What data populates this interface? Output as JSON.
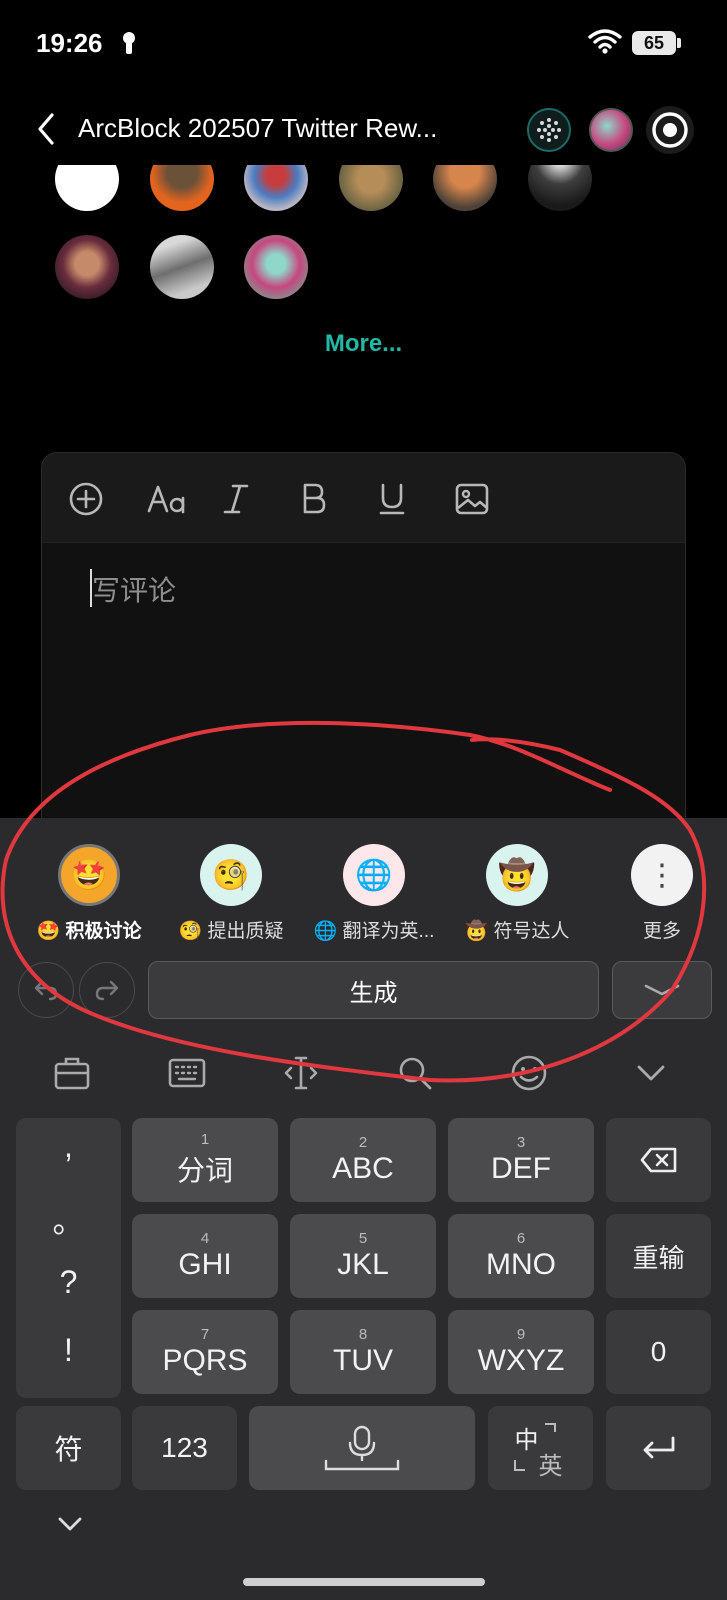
{
  "status_bar": {
    "time": "19:26",
    "battery": "65"
  },
  "header": {
    "title": "ArcBlock 202507 Twitter Rew..."
  },
  "avatars_more": "More...",
  "editor": {
    "placeholder": "写评论"
  },
  "suggestions": [
    {
      "emoji": "🤩",
      "label": "🤩 积极讨论",
      "selected": true
    },
    {
      "emoji": "🧐",
      "label": "🧐 提出质疑"
    },
    {
      "emoji": "🌐",
      "label": "🌐 翻译为英..."
    },
    {
      "emoji": "🤠",
      "label": "🤠 符号达人"
    },
    {
      "emoji": "⋮",
      "label": "更多"
    }
  ],
  "generate_label": "生成",
  "keyboard": {
    "punct": [
      ",",
      "。",
      "?",
      "!"
    ],
    "rows": [
      [
        {
          "num": "1",
          "label": "分词"
        },
        {
          "num": "2",
          "label": "ABC"
        },
        {
          "num": "3",
          "label": "DEF"
        }
      ],
      [
        {
          "num": "4",
          "label": "GHI"
        },
        {
          "num": "5",
          "label": "JKL"
        },
        {
          "num": "6",
          "label": "MNO"
        }
      ],
      [
        {
          "num": "7",
          "label": "PQRS"
        },
        {
          "num": "8",
          "label": "TUV"
        },
        {
          "num": "9",
          "label": "WXYZ"
        }
      ]
    ],
    "reenter": "重输",
    "zero": "0",
    "symbol": "符",
    "numbers": "123",
    "lang_top": "中",
    "lang_bottom": "英"
  },
  "colors": {
    "accent": "#22b8a7",
    "annotation": "#e0383e",
    "keyboard_bg": "#2b2b2d"
  }
}
